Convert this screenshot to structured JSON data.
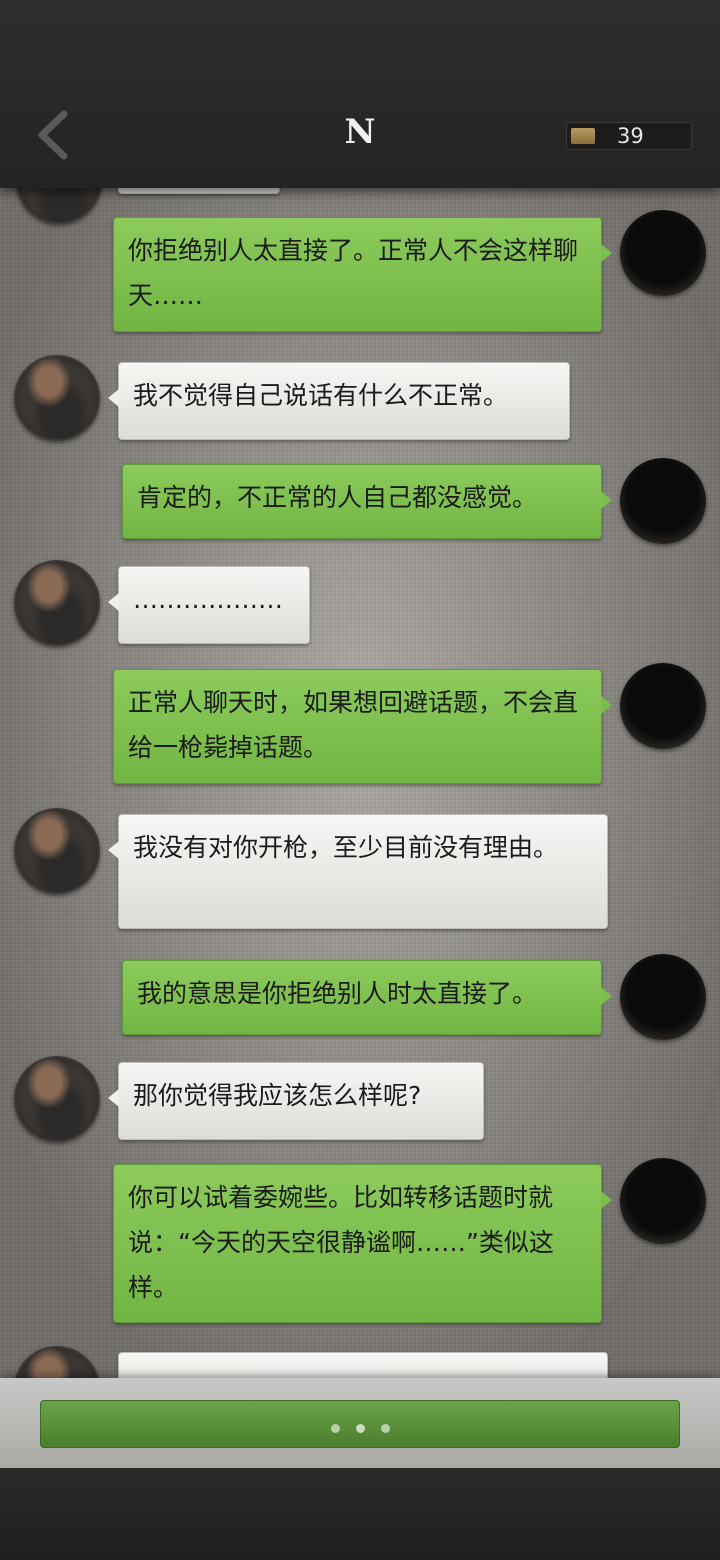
{
  "header": {
    "title": "N",
    "coins": "39"
  },
  "messages": [
    {
      "side": "right",
      "text": "你拒绝别人太直接了。正常人不会这样聊天……"
    },
    {
      "side": "left",
      "text": "我不觉得自己说话有什么不正常。"
    },
    {
      "side": "right",
      "text": "肯定的，不正常的人自己都没感觉。"
    },
    {
      "side": "left",
      "text": "………………"
    },
    {
      "side": "right",
      "text": "正常人聊天时，如果想回避话题，不会直给一枪毙掉话题。"
    },
    {
      "side": "left",
      "text": "我没有对你开枪，至少目前没有理由。"
    },
    {
      "side": "right",
      "text": "我的意思是你拒绝别人时太直接了。"
    },
    {
      "side": "left",
      "text": "那你觉得我应该怎么样呢?"
    },
    {
      "side": "right",
      "text": "你可以试着委婉些。比如转移话题时就说：“今天的天空很静谧啊……”类似这样。"
    }
  ],
  "continue_button": {
    "state": "typing",
    "dots": 3
  }
}
